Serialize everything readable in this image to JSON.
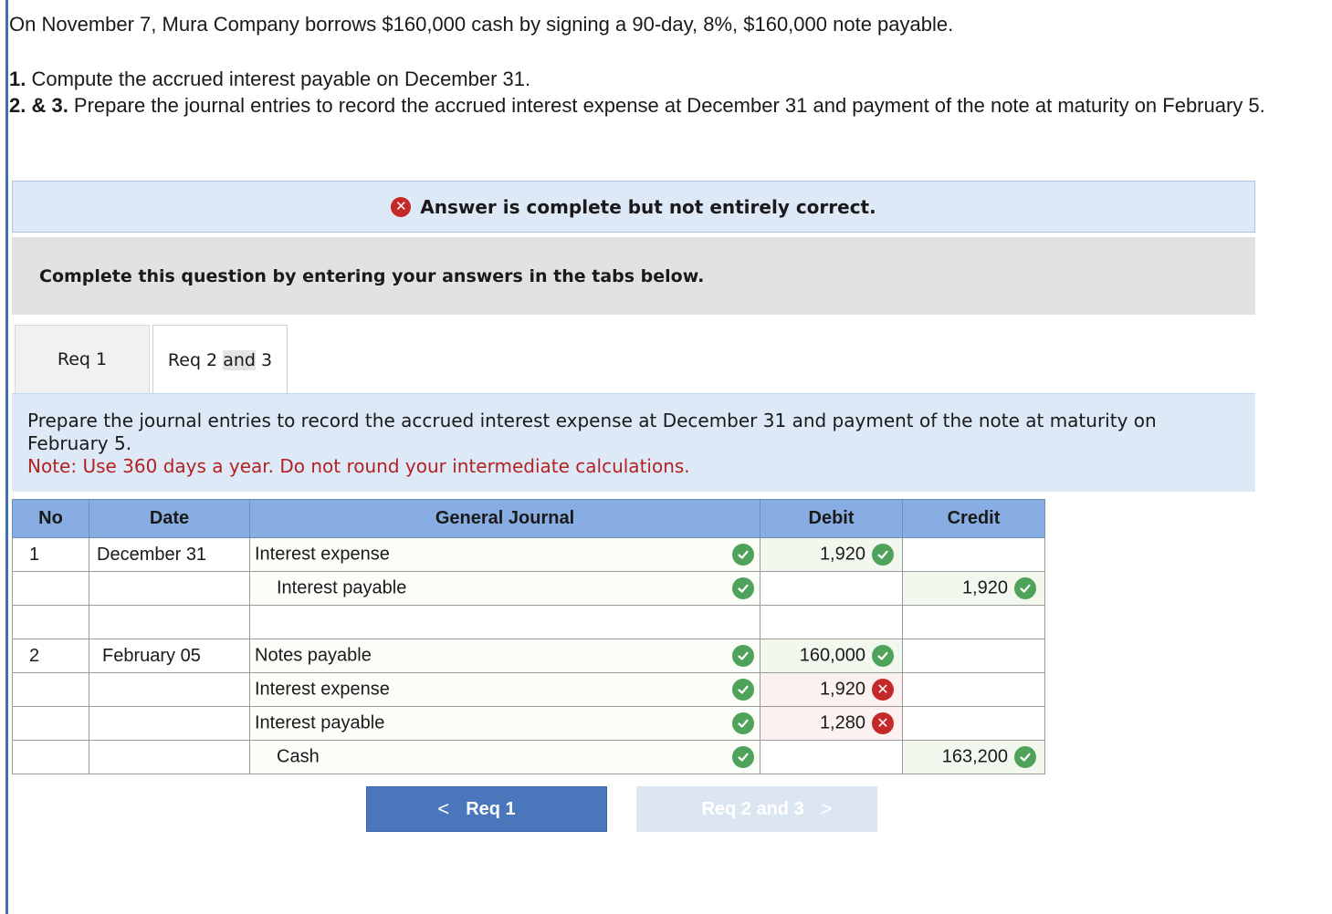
{
  "question": {
    "intro": "On November 7, Mura Company borrows $160,000 cash by signing a 90-day, 8%, $160,000 note payable.",
    "req1_num": "1.",
    "req1_text": " Compute the accrued interest payable on December 31.",
    "req23_num": "2. & 3.",
    "req23_text": " Prepare the journal entries to record the accrued interest expense at December 31 and payment of the note at maturity on February 5."
  },
  "banner": {
    "icon": "x-circle-icon",
    "text": "Answer is complete but not entirely correct."
  },
  "instruction": "Complete this question by entering your answers in the tabs below.",
  "tabs": {
    "req1": "Req 1",
    "req23_prefix": "Req 2 ",
    "req23_highlight": "and",
    "req23_suffix": " 3"
  },
  "prompt": {
    "text": "Prepare the journal entries to record the accrued interest expense at December 31 and payment of the note at maturity on February 5.",
    "note": "Note: Use 360 days a year. Do not round your intermediate calculations."
  },
  "journal": {
    "headers": {
      "no": "No",
      "date": "Date",
      "gj": "General Journal",
      "debit": "Debit",
      "credit": "Credit"
    },
    "rows": [
      {
        "no": "1",
        "date": "December 31",
        "account": "Interest expense",
        "debit": "1,920",
        "credit": ""
      },
      {
        "no": "",
        "date": "",
        "account": "Interest payable",
        "debit": "",
        "credit": "1,920"
      },
      {
        "no": "",
        "date": "",
        "account": "",
        "debit": "",
        "credit": ""
      },
      {
        "no": "2",
        "date": "February 05",
        "account": "Notes payable",
        "debit": "160,000",
        "credit": ""
      },
      {
        "no": "",
        "date": "",
        "account": "Interest expense",
        "debit": "1,920",
        "credit": ""
      },
      {
        "no": "",
        "date": "",
        "account": "Interest payable",
        "debit": "1,280",
        "credit": ""
      },
      {
        "no": "",
        "date": "",
        "account": "Cash",
        "debit": "",
        "credit": "163,200"
      }
    ]
  },
  "nav": {
    "prev_label": "Req 1",
    "next_label": "Req 2 and 3",
    "prev_chevron": "<",
    "next_chevron": ">"
  },
  "colors": {
    "correct": "#4ea25a",
    "incorrect": "#c52828",
    "header_blue": "#87ade2",
    "button_blue": "#4a76bb",
    "note_red": "#b22222"
  }
}
